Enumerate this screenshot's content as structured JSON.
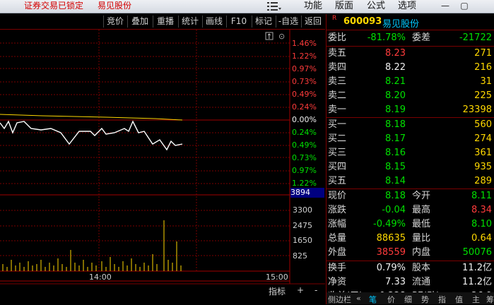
{
  "titlebar": {
    "lock_status": "证券交易已锁定",
    "stock_name": "易见股份",
    "menus": [
      "功能",
      "版面",
      "公式",
      "选项"
    ],
    "win_minimize": "—",
    "win_restore": "▢"
  },
  "toolbar": {
    "buttons": [
      "竞价",
      "叠加",
      "重播",
      "统计",
      "画线",
      "F10",
      "标记",
      "-自选",
      "返回"
    ]
  },
  "chart": {
    "pct_labels_up": [
      "1.46%",
      "1.22%",
      "0.97%",
      "0.73%",
      "0.49%",
      "0.24%"
    ],
    "zero_label": "0.00%",
    "pct_labels_down": [
      "0.24%",
      "0.49%",
      "0.73%",
      "0.97%",
      "1.22%"
    ],
    "volume_labels": [
      "3894",
      "3300",
      "2475",
      "1650",
      "825"
    ],
    "time_labels": [
      "14:00",
      "15:00"
    ],
    "indicator_btn": "指标",
    "plus_btn": "+",
    "minus_btn": "-",
    "up_arrow": "↑"
  },
  "quote": {
    "marker": "R",
    "code": "600093",
    "name": "易见股份",
    "weibi_label": "委比",
    "weibi": "-81.78%",
    "weicha_label": "委差",
    "weicha": "-21722",
    "sell": [
      {
        "label": "卖五",
        "price": "8.23",
        "vol": "271"
      },
      {
        "label": "卖四",
        "price": "8.22",
        "vol": "216"
      },
      {
        "label": "卖三",
        "price": "8.21",
        "vol": "31"
      },
      {
        "label": "卖二",
        "price": "8.20",
        "vol": "225"
      },
      {
        "label": "卖一",
        "price": "8.19",
        "vol": "23398"
      }
    ],
    "buy": [
      {
        "label": "买一",
        "price": "8.18",
        "vol": "560"
      },
      {
        "label": "买二",
        "price": "8.17",
        "vol": "274"
      },
      {
        "label": "买三",
        "price": "8.16",
        "vol": "361"
      },
      {
        "label": "买四",
        "price": "8.15",
        "vol": "935"
      },
      {
        "label": "买五",
        "price": "8.14",
        "vol": "289"
      }
    ],
    "stats": [
      {
        "l1": "现价",
        "v1": "8.18",
        "c1": "green",
        "l2": "今开",
        "v2": "8.11",
        "c2": "green"
      },
      {
        "l1": "涨跌",
        "v1": "-0.04",
        "c1": "green",
        "l2": "最高",
        "v2": "8.34",
        "c2": "red"
      },
      {
        "l1": "涨幅",
        "v1": "-0.49%",
        "c1": "green",
        "l2": "最低",
        "v2": "8.10",
        "c2": "green"
      },
      {
        "l1": "总量",
        "v1": "88635",
        "c1": "yellow",
        "l2": "量比",
        "v2": "0.64",
        "c2": "yellow"
      },
      {
        "l1": "外盘",
        "v1": "38559",
        "c1": "red",
        "l2": "内盘",
        "v2": "50076",
        "c2": "green"
      }
    ],
    "stats2": [
      {
        "l1": "换手",
        "v1": "0.79%",
        "l2": "股本",
        "v2": "11.2亿"
      },
      {
        "l1": "净资",
        "v1": "7.33",
        "l2": "流通",
        "v2": "11.2亿"
      },
      {
        "l1": "收益(三)",
        "v1": "0.228",
        "l2": "PE(动)",
        "v2": "26.9"
      }
    ],
    "bottom_tabs": [
      "侧边栏",
      "«",
      "笔",
      "价",
      "细",
      "势",
      "指",
      "值",
      "主",
      "筹"
    ]
  },
  "colors": {
    "up": "#ff3b3b",
    "down": "#00e000",
    "accent": "#ffd800",
    "grid": "#7a0000"
  }
}
